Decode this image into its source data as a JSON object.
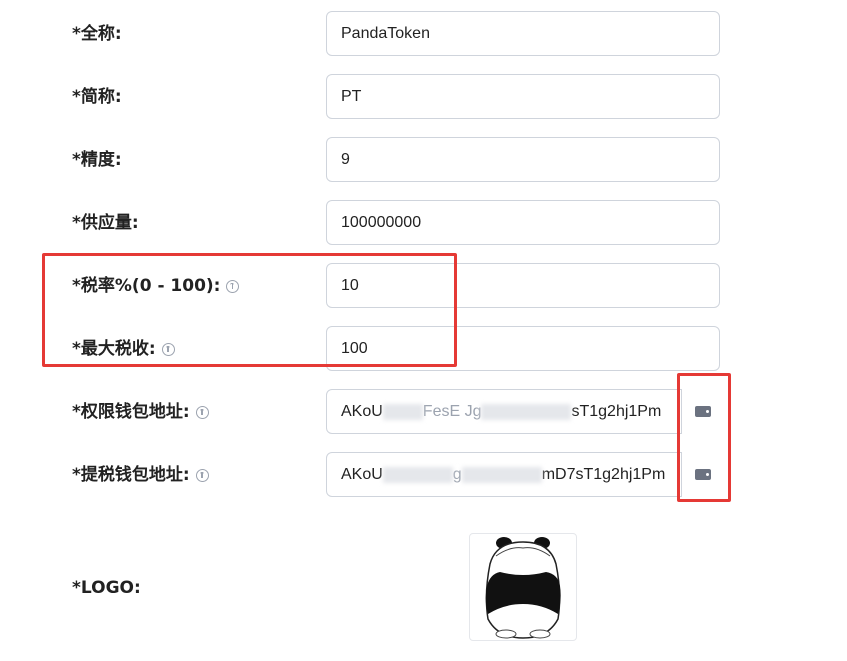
{
  "form": {
    "fullname": {
      "label": "*全称:",
      "value": "PandaToken"
    },
    "symbol": {
      "label": "*简称:",
      "value": "PT"
    },
    "decimals": {
      "label": "*精度:",
      "value": "9"
    },
    "supply": {
      "label": "*供应量:",
      "value": "100000000"
    },
    "tax_rate": {
      "label": "*税率%(0 - 100):",
      "value": "10"
    },
    "max_tax": {
      "label": "*最大税收:",
      "value": "100"
    },
    "authority_wallet": {
      "label": "*权限钱包地址:",
      "value_prefix": "AKoU",
      "value_mid": "FesE Jg",
      "value_suffix": "sT1g2hj1Pm"
    },
    "tax_wallet": {
      "label": "*提税钱包地址:",
      "value_prefix": "AKoU",
      "value_mid": "g",
      "value_suffix": "mD7sT1g2hj1Pm"
    },
    "logo": {
      "label": "*LOGO:"
    }
  },
  "icons": {
    "help": "help-circle-icon",
    "wallet": "wallet-icon"
  },
  "colors": {
    "highlight": "#e53935",
    "input_border": "#cfd4dc"
  }
}
